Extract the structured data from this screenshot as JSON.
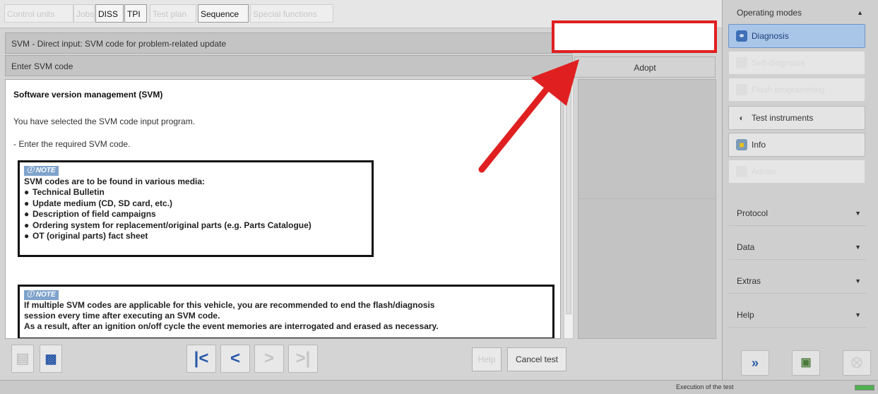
{
  "tabs": [
    {
      "label": "Control units",
      "state": "faded"
    },
    {
      "label": "Jobs",
      "state": "faded"
    },
    {
      "label": "DISS",
      "state": "normal"
    },
    {
      "label": "TPI",
      "state": "normal"
    },
    {
      "label": "Test plan",
      "state": "faded"
    },
    {
      "label": "Sequence",
      "state": "active"
    },
    {
      "label": "Special functions",
      "state": "faded"
    }
  ],
  "header": {
    "title": "SVM - Direct input: SVM code for problem-related update",
    "prompt": "Enter SVM code",
    "adopt_label": "Adopt"
  },
  "content": {
    "title": "Software version management (SVM)",
    "line1": "You have selected the SVM code input program.",
    "line2": "- Enter the required SVM code.",
    "note1": {
      "badge": "NOTE",
      "heading": "SVM codes are to be found in various media:",
      "items": [
        "Technical Bulletin",
        "Update medium (CD, SD card, etc.)",
        "Description of field campaigns",
        "Ordering system for replacement/original parts (e.g. Parts Catalogue)",
        "OT (original parts) fact sheet"
      ]
    },
    "note2": {
      "badge": "NOTE",
      "line1": "If multiple SVM codes are applicable for this vehicle, you are recommended to end the flash/diagnosis",
      "line2": "session every time after executing an SVM code.",
      "line3": "As a result, after an ignition on/off cycle the event memories are interrogated and erased as necessary."
    }
  },
  "toolbar": {
    "help_label": "Help",
    "cancel_label": "Cancel test"
  },
  "status": {
    "text": "Execution of the test",
    "progress": 1.0
  },
  "right_panel": {
    "operating_modes_label": "Operating modes",
    "modes": [
      {
        "label": "Diagnosis",
        "state": "active",
        "icon": "stethoscope-icon"
      },
      {
        "label": "Self-diagnosis",
        "state": "dim",
        "icon": "self-diagnosis-icon"
      },
      {
        "label": "Flash programming",
        "state": "dim",
        "icon": "flash-icon"
      },
      {
        "label": "Test instruments",
        "state": "normal",
        "icon": "gauge-icon"
      },
      {
        "label": "Info",
        "state": "normal",
        "icon": "info-icon"
      },
      {
        "label": "Admin",
        "state": "dim",
        "icon": "admin-icon"
      }
    ],
    "sections": [
      {
        "label": "Protocol"
      },
      {
        "label": "Data"
      },
      {
        "label": "Extras"
      },
      {
        "label": "Help"
      }
    ]
  },
  "colors": {
    "highlight": "#e02020",
    "active_mode": "#a9c6e8",
    "nav_blue": "#2a58a8",
    "progress_green": "#4fb04f"
  }
}
